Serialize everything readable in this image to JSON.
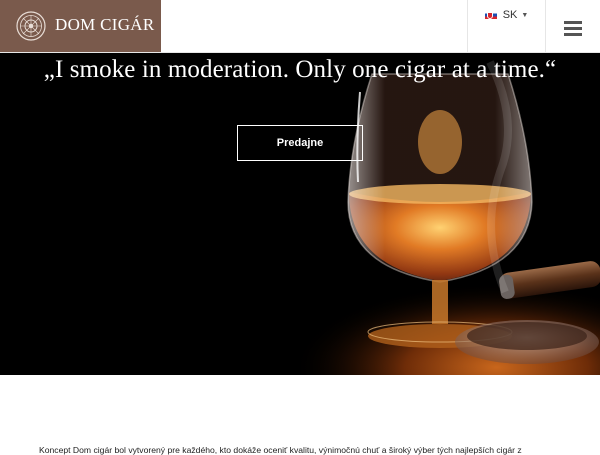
{
  "header": {
    "logo_text": "DOM CIGÁR",
    "language": "SK",
    "colors": {
      "logo_bg": "#7a5a4c",
      "menu_icon": "#555555"
    },
    "icons": {
      "logo": "ornamental-seal-icon",
      "flag": "slovakia-flag-icon",
      "caret": "caret-down-icon",
      "menu": "hamburger-menu-icon"
    }
  },
  "hero": {
    "quote": "„I smoke in moderation. Only one cigar at a time.“",
    "button_label": "Predajne"
  },
  "intro": {
    "text": "Koncept Dom cigár bol vytvorený pre každého, kto dokáže oceniť kvalitu, výnimočnú chuť a široký výber tých najlepších cigár z"
  }
}
